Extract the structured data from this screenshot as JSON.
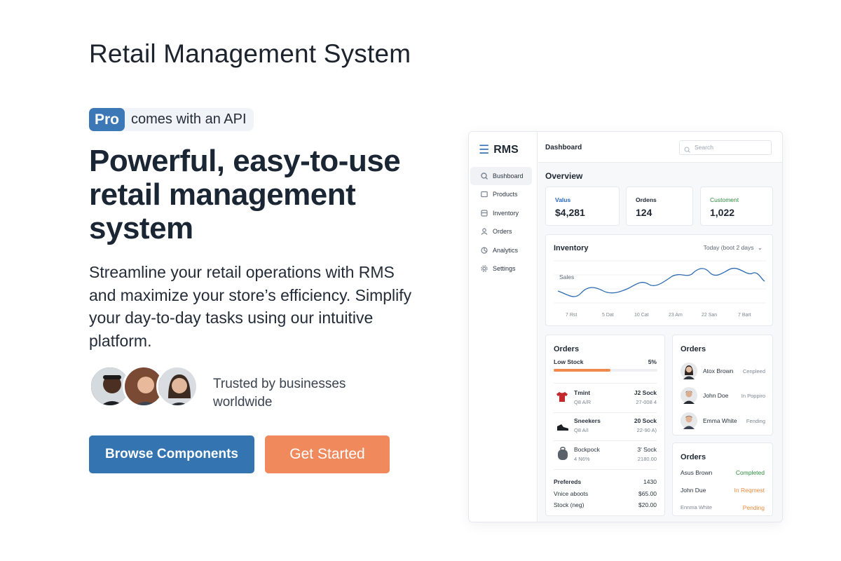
{
  "page": {
    "title": "Retail Management System",
    "badge": "Pro",
    "badge_text": "comes with an API",
    "heading": "Powerful, easy-to-use retail management system",
    "description": "Streamline your retail operations with RMS and maximize your store’s efficiency. Simplify your day-to-day tasks using our intuitive platform.",
    "trusted": "Trusted by businesses worldwide",
    "buttons": {
      "browse": "Browse Components",
      "start": "Get Started"
    }
  },
  "colors": {
    "primary": "#3474b0",
    "accent": "#f08a5d",
    "badge": "#3b78b5",
    "success": "#2e8b3e",
    "warning": "#f08a3c"
  },
  "dashboard": {
    "brand": "RMS",
    "nav": [
      {
        "label": "Bushboard",
        "icon": "dashboard-icon"
      },
      {
        "label": "Products",
        "icon": "box-icon"
      },
      {
        "label": "Inventory",
        "icon": "inventory-icon"
      },
      {
        "label": "Orders",
        "icon": "user-icon"
      },
      {
        "label": "Analytics",
        "icon": "analytics-icon"
      },
      {
        "label": "Settings",
        "icon": "gear-icon"
      }
    ],
    "topbar_title": "Dashboard",
    "search_placeholder": "Search",
    "overview_title": "Overview",
    "stats": [
      {
        "label": "Valus",
        "value": "$4,281",
        "color": "#2a66c0"
      },
      {
        "label": "Ordens",
        "value": "124",
        "color": "#1f2733"
      },
      {
        "label": "Customent",
        "value": "1,022",
        "color": "#2e8b3e"
      }
    ],
    "inventory": {
      "title": "Inventory",
      "range": "Today (boot 2 days",
      "series_label": "Sales",
      "x_labels": [
        "7 Rst",
        "5 Dat",
        "10 Cat",
        "23 Am",
        "22 San",
        "7 Bart"
      ]
    },
    "orders_panel": {
      "title": "Orders",
      "low_stock_label": "Low Stock",
      "low_stock_pct": "5%",
      "low_stock_fill": 0.55,
      "products": [
        {
          "name": "Tmint",
          "sub": "Q8 A/R",
          "stock": "J2 Sock",
          "code": "27-008 4",
          "icon": "tshirt-icon"
        },
        {
          "name": "Sneekers",
          "sub": "Q8 A/I",
          "stock": "20 Sock",
          "code": "22-90 A)",
          "icon": "sneaker-icon"
        },
        {
          "name": "Bockpock",
          "sub": "4 N6%",
          "stock": "3' Sock",
          "code": "2180.00",
          "icon": "backpack-icon"
        }
      ],
      "summary": [
        {
          "label": "Prefereds",
          "value": "1430"
        },
        {
          "label": "Vnice aboots",
          "value": "$65.00"
        },
        {
          "label": "Stock (neg)",
          "value": "$20.00"
        }
      ]
    },
    "customers_panel": {
      "title": "Orders",
      "items": [
        {
          "name": "Atox Brown",
          "status": "Cenpleed"
        },
        {
          "name": "John Doe",
          "status": "In Poppiro"
        },
        {
          "name": "Emma White",
          "status": "Fending"
        }
      ]
    },
    "status_panel": {
      "title": "Orders",
      "items": [
        {
          "name": "Asus Brown",
          "status": "Completed",
          "color": "#2e8b3e"
        },
        {
          "name": "John Due",
          "status": "In Reqmest",
          "color": "#f08a3c"
        },
        {
          "name": "Ennma White",
          "status": "Pending",
          "color": "#f08a3c"
        }
      ]
    }
  }
}
